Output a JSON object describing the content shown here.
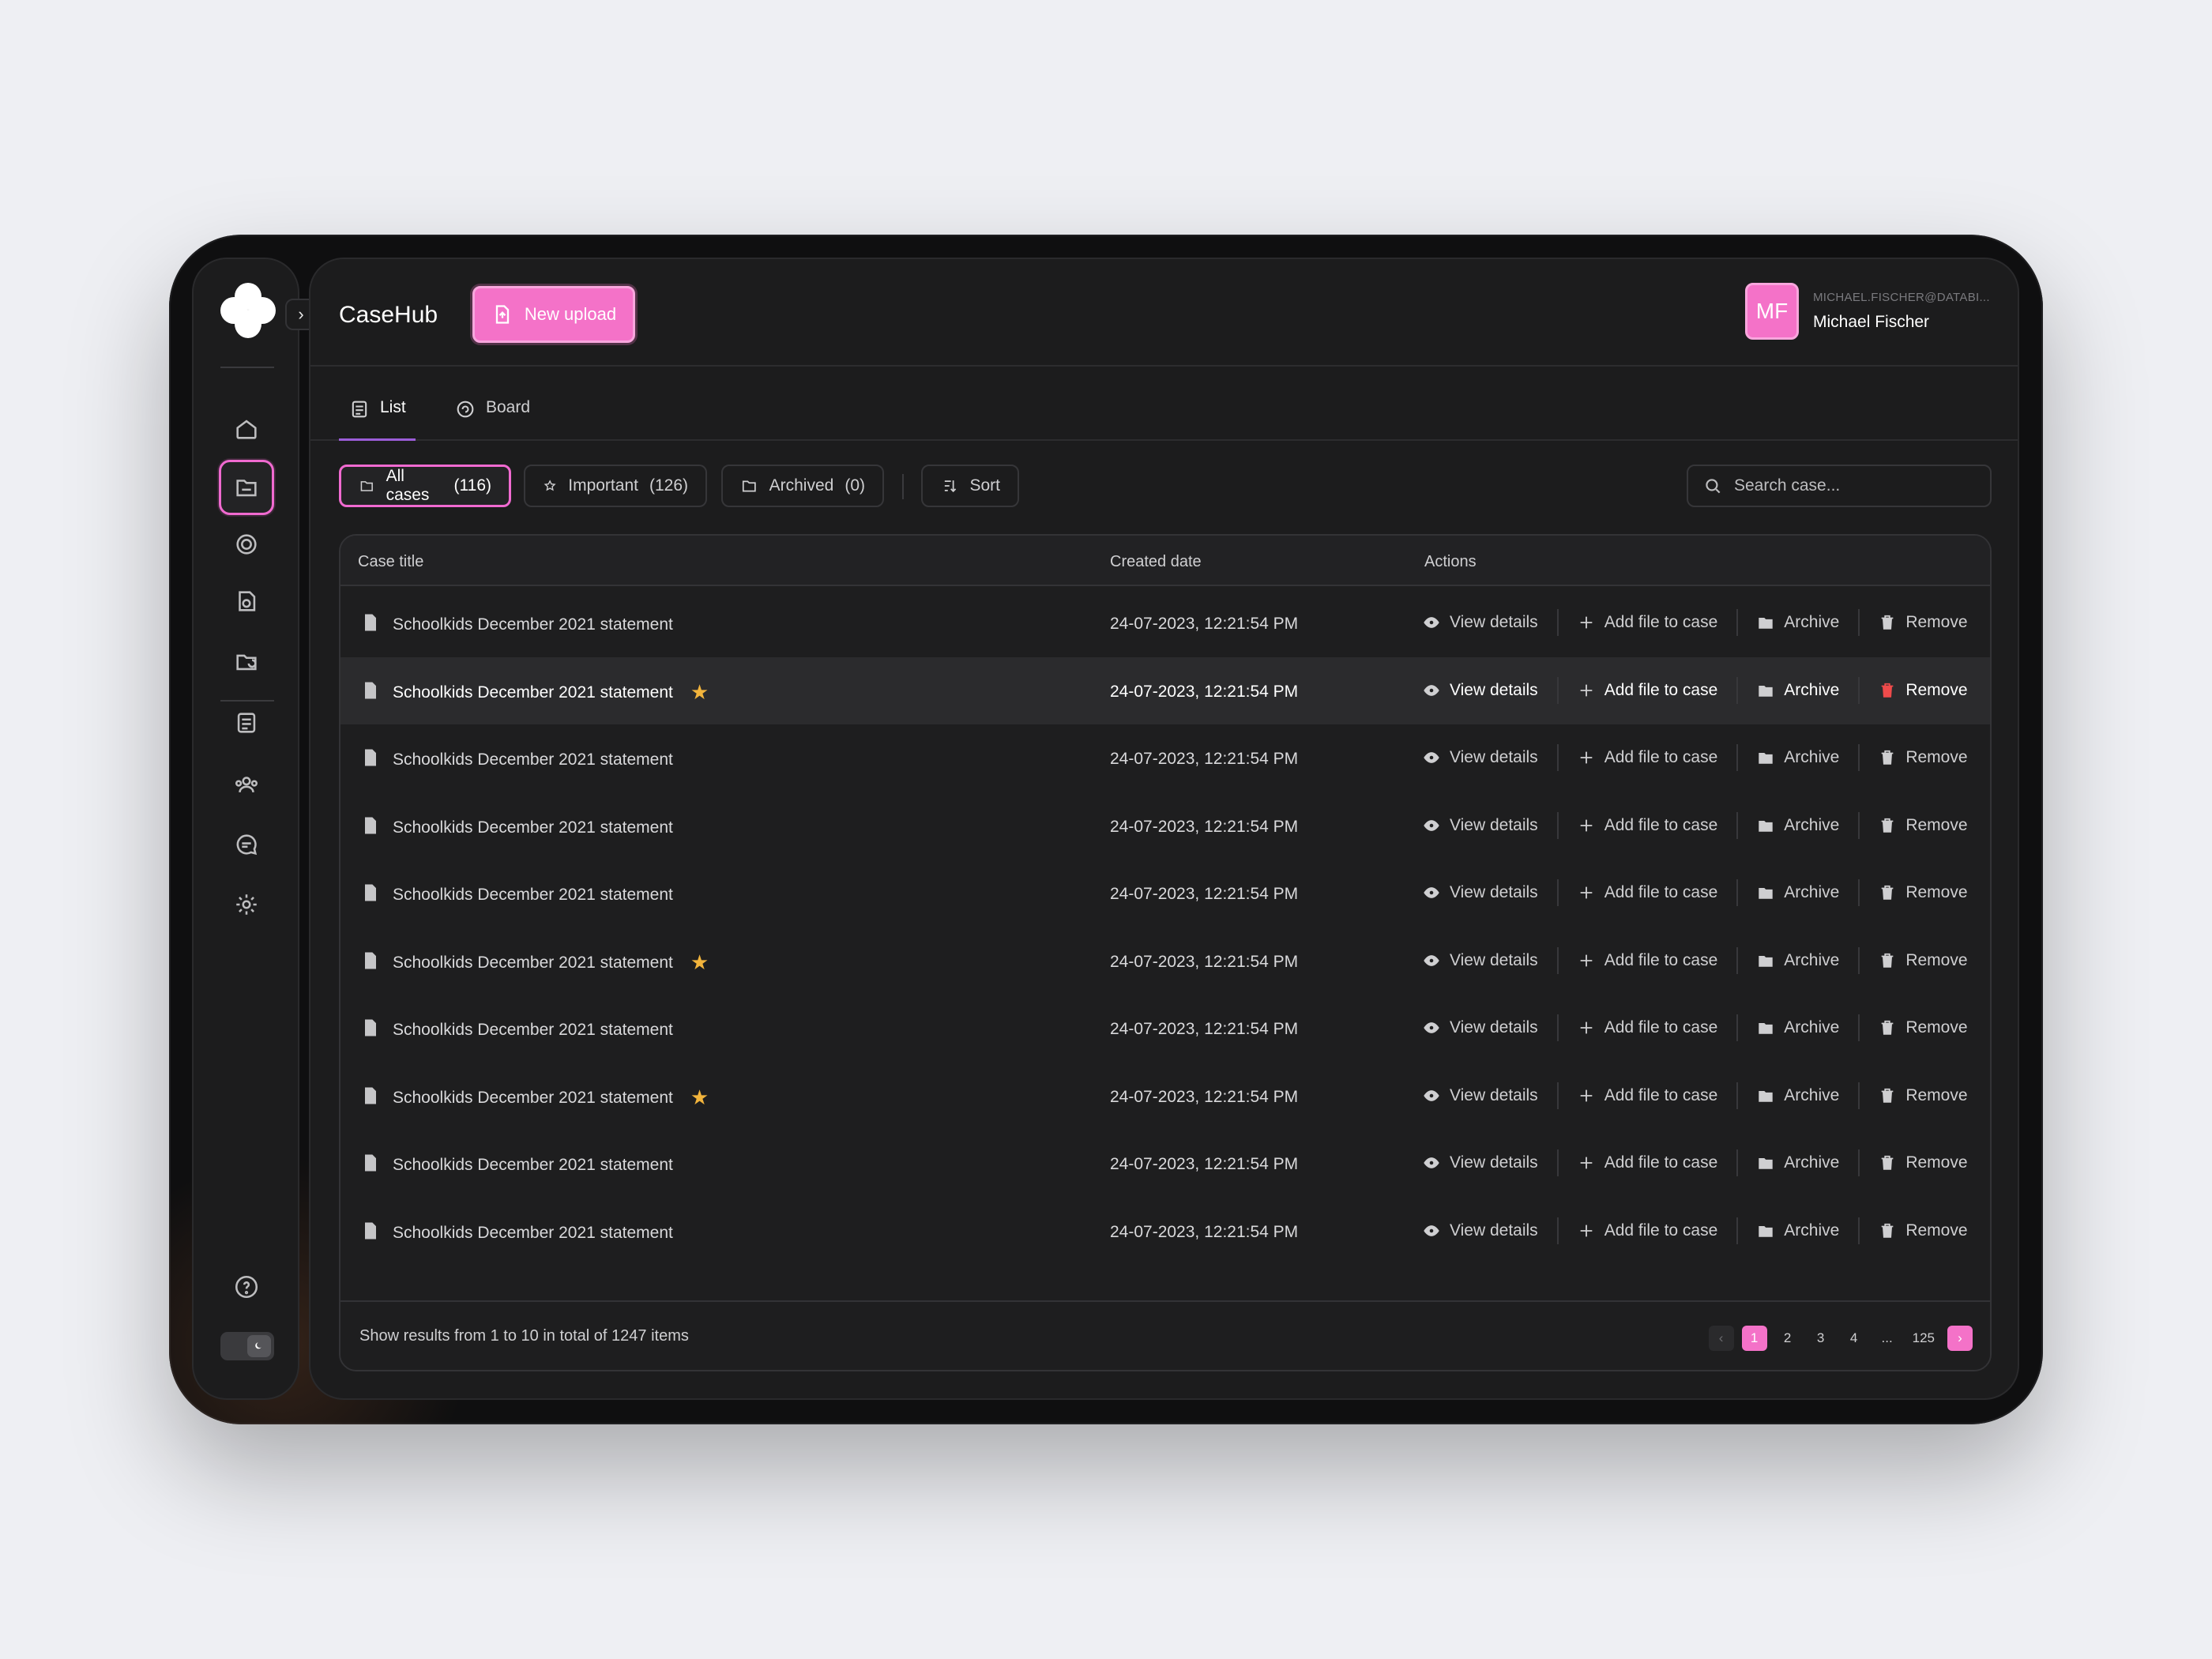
{
  "app": {
    "title": "CaseHub",
    "new_upload_label": "New upload"
  },
  "user": {
    "initials": "MF",
    "email": "MICHAEL.FISCHER@DATABI...",
    "name": "Michael Fischer"
  },
  "colors": {
    "accent": "#f472c8",
    "tab_underline": "#9b5dd8",
    "star": "#f2b43c",
    "danger": "#ef4b4b",
    "background": "#1c1c1d"
  },
  "sidebar": {
    "items": [
      {
        "icon": "home-icon",
        "active": false
      },
      {
        "icon": "folder-cases-icon",
        "active": true
      },
      {
        "icon": "shield-icon",
        "active": false
      },
      {
        "icon": "document-icon",
        "active": false
      },
      {
        "icon": "refresh-folder-icon",
        "active": false
      },
      {
        "icon": "list-icon",
        "active": false
      },
      {
        "icon": "users-icon",
        "active": false
      },
      {
        "icon": "chat-icon",
        "active": false
      },
      {
        "icon": "gear-icon",
        "active": false
      }
    ],
    "help_icon": "help-icon",
    "theme_toggle_icon": "moon-icon"
  },
  "view_tabs": [
    {
      "label": "List",
      "active": true,
      "icon": "list-icon"
    },
    {
      "label": "Board",
      "active": false,
      "icon": "board-icon"
    }
  ],
  "filters": [
    {
      "label": "All cases",
      "count": "(116)",
      "active": true
    },
    {
      "label": "Important",
      "count": "(126)",
      "active": false
    },
    {
      "label": "Archived",
      "count": "(0)",
      "active": false
    }
  ],
  "sort_label": "Sort",
  "search": {
    "placeholder": "Search case..."
  },
  "table": {
    "columns": [
      "Case title",
      "Created date",
      "Actions"
    ],
    "actions": {
      "view": "View details",
      "add": "Add file to case",
      "archive": "Archive",
      "remove": "Remove"
    },
    "rows": [
      {
        "title": "Schoolkids December 2021 statement",
        "date": "24-07-2023, 12:21:54 PM",
        "starred": false,
        "hover": false
      },
      {
        "title": "Schoolkids December 2021 statement",
        "date": "24-07-2023, 12:21:54 PM",
        "starred": true,
        "hover": true
      },
      {
        "title": "Schoolkids December 2021 statement",
        "date": "24-07-2023, 12:21:54 PM",
        "starred": false,
        "hover": false
      },
      {
        "title": "Schoolkids December 2021 statement",
        "date": "24-07-2023, 12:21:54 PM",
        "starred": false,
        "hover": false
      },
      {
        "title": "Schoolkids December 2021 statement",
        "date": "24-07-2023, 12:21:54 PM",
        "starred": false,
        "hover": false
      },
      {
        "title": "Schoolkids December 2021 statement",
        "date": "24-07-2023, 12:21:54 PM",
        "starred": true,
        "hover": false
      },
      {
        "title": "Schoolkids December 2021 statement",
        "date": "24-07-2023, 12:21:54 PM",
        "starred": false,
        "hover": false
      },
      {
        "title": "Schoolkids December 2021 statement",
        "date": "24-07-2023, 12:21:54 PM",
        "starred": true,
        "hover": false
      },
      {
        "title": "Schoolkids December 2021 statement",
        "date": "24-07-2023, 12:21:54 PM",
        "starred": false,
        "hover": false
      },
      {
        "title": "Schoolkids December 2021 statement",
        "date": "24-07-2023, 12:21:54 PM",
        "starred": false,
        "hover": false
      }
    ]
  },
  "footer": {
    "summary": "Show results from 1 to 10 in total of 1247 items",
    "pages": [
      "1",
      "2",
      "3",
      "4",
      "...",
      "125"
    ],
    "current_page": "1",
    "prev_label": "‹",
    "next_label": "›"
  }
}
